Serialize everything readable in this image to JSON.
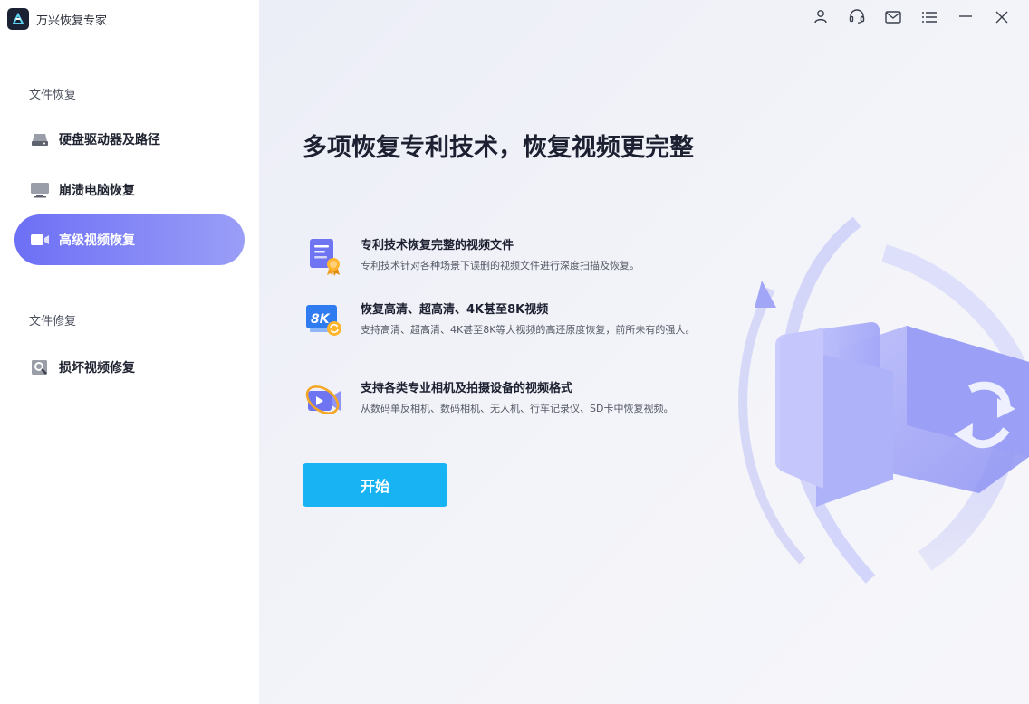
{
  "app": {
    "title": "万兴恢复专家"
  },
  "sidebar": {
    "section_file_recovery": "文件恢复",
    "section_file_repair": "文件修复",
    "items": [
      {
        "label": "硬盘驱动器及路径",
        "icon": "hard-drive-icon"
      },
      {
        "label": "崩溃电脑恢复",
        "icon": "monitor-icon"
      },
      {
        "label": "高级视频恢复",
        "icon": "video-camera-icon",
        "active": true
      },
      {
        "label": "损坏视频修复",
        "icon": "video-repair-icon"
      }
    ]
  },
  "main": {
    "headline": "多项恢复专利技术，恢复视频更完整",
    "features": [
      {
        "title": "专利技术恢复完整的视频文件",
        "desc": "专利技术针对各种场景下误删的视频文件进行深度扫描及恢复。",
        "icon": "certificate-icon"
      },
      {
        "title": "恢复高清、超高清、4K甚至8K视频",
        "desc": "支持高清、超高清、4K甚至8K等大视频的高还原度恢复，前所未有的强大。",
        "icon": "8k-icon",
        "badge": "8K"
      },
      {
        "title": "支持各类专业相机及拍摄设备的视频格式",
        "desc": "从数码单反相机、数码相机、无人机、行车记录仪、SD卡中恢复视频。",
        "icon": "camera-orbit-icon"
      }
    ],
    "start_label": "开始"
  },
  "window_controls": [
    "user-icon",
    "headset-icon",
    "mail-icon",
    "menu-icon",
    "minimize-icon",
    "close-icon"
  ],
  "colors": {
    "accent": "#6d6ff5",
    "button": "#17b3f2"
  }
}
